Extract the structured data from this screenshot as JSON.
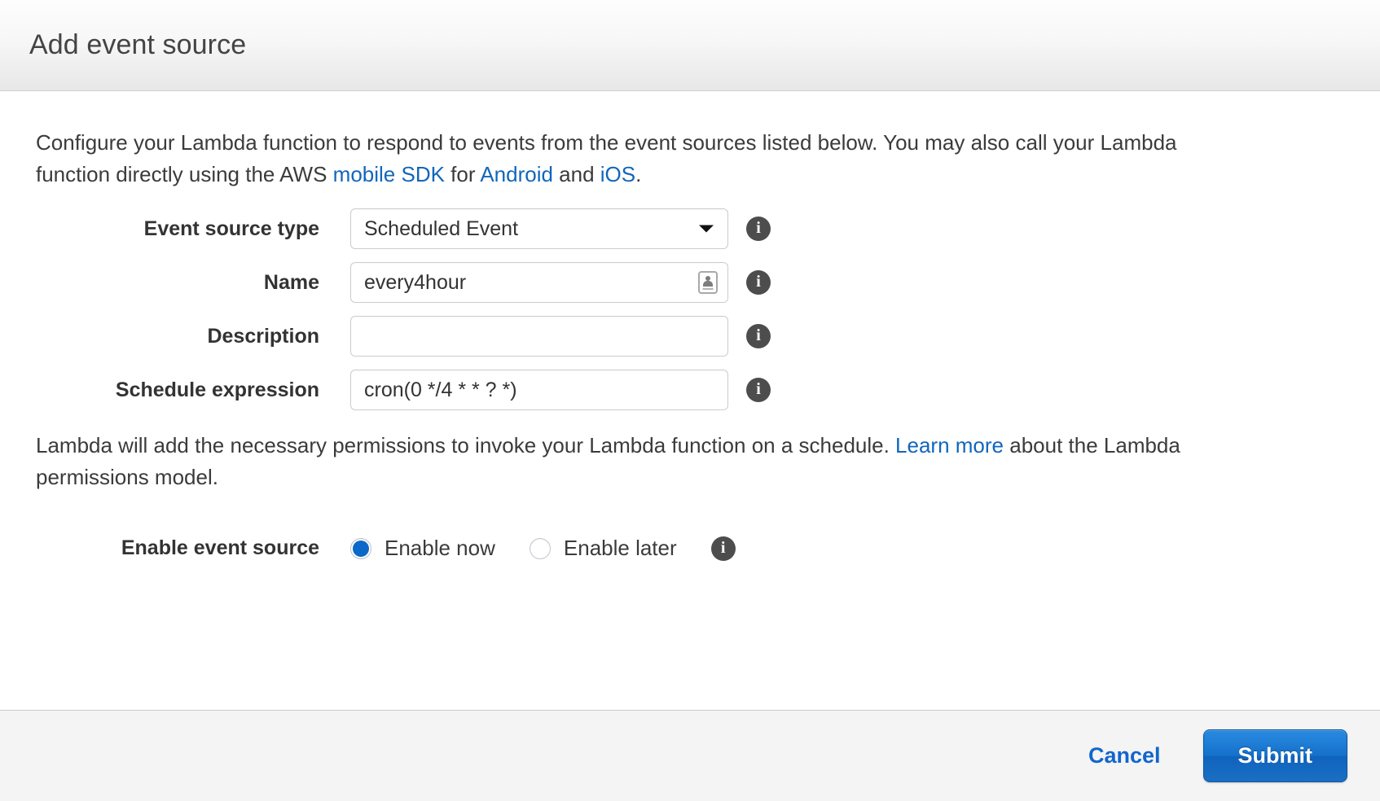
{
  "header": {
    "title": "Add event source"
  },
  "intro": {
    "part1": "Configure your Lambda function to respond to events from the event sources listed below. You may also call your Lambda function directly using the AWS ",
    "link_mobile_sdk": "mobile SDK",
    "part2": " for ",
    "link_android": "Android",
    "part3": " and ",
    "link_ios": "iOS",
    "part4": "."
  },
  "form": {
    "event_source_type": {
      "label": "Event source type",
      "value": "Scheduled Event",
      "options": [
        "Scheduled Event"
      ],
      "info_icon": "info-icon"
    },
    "name": {
      "label": "Name",
      "value": "every4hour",
      "placeholder": "",
      "autofill_icon": "contact-card-icon",
      "info_icon": "info-icon"
    },
    "description": {
      "label": "Description",
      "value": "",
      "placeholder": "",
      "info_icon": "info-icon"
    },
    "schedule_expression": {
      "label": "Schedule expression",
      "value": "cron(0 */4 * * ? *)",
      "placeholder": "",
      "info_icon": "info-icon"
    }
  },
  "permissions": {
    "part1": "Lambda will add the necessary permissions to invoke your Lambda function on a schedule. ",
    "link_learn_more": "Learn more",
    "part2": " about the Lambda permissions model."
  },
  "enable": {
    "label": "Enable event source",
    "options": [
      {
        "label": "Enable now",
        "selected": true
      },
      {
        "label": "Enable later",
        "selected": false
      }
    ],
    "info_icon": "info-icon"
  },
  "footer": {
    "cancel_label": "Cancel",
    "submit_label": "Submit"
  },
  "colors": {
    "link": "#1166bb",
    "accent_blue": "#0b68c8",
    "submit_button": "#1471cc",
    "header_text": "#444444",
    "footer_background": "#f4f4f4"
  }
}
